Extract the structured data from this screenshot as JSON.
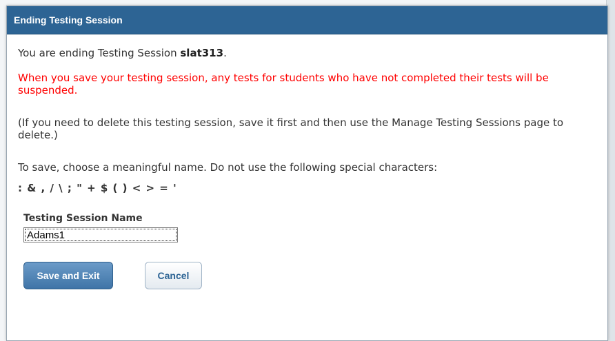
{
  "dialog": {
    "title": "Ending Testing Session",
    "intro_prefix": "You are ending Testing Session ",
    "session_id": "slat313",
    "intro_suffix": ".",
    "warning": "When you save your testing session, any tests for students who have not completed their tests will be suspended.",
    "delete_note": "(If you need to delete this testing session, save it first and then use the Manage Testing Sessions page to delete.)",
    "naming_instruction": "To save, choose a meaningful name. Do not use the following special characters:",
    "special_characters": ": & , / \\ ; \" + $ ( ) < > = '",
    "field_label": "Testing Session Name",
    "field_value": "Adams1",
    "save_button": "Save and Exit",
    "cancel_button": "Cancel"
  },
  "colors": {
    "titlebar": "#2d6494",
    "warning_text": "#ff0000",
    "primary_button": "#4a7fb2"
  }
}
